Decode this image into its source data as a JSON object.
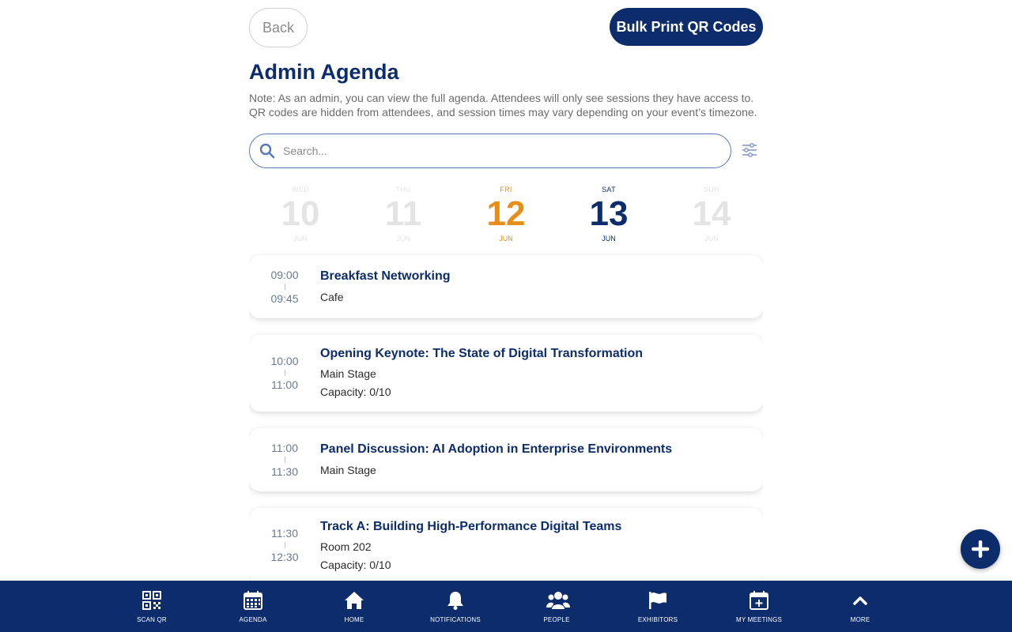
{
  "header": {
    "back_label": "Back",
    "bulk_label": "Bulk Print QR Codes",
    "title": "Admin Agenda",
    "note": "Note: As an admin, you can view the full agenda. Attendees will only see sessions they have access to. QR codes are hidden from attendees, and session times may vary depending on your event’s timezone."
  },
  "search": {
    "placeholder": "Search..."
  },
  "days": [
    {
      "dow": "WED",
      "num": "10",
      "mon": "JUN",
      "state": "muted"
    },
    {
      "dow": "THU",
      "num": "11",
      "mon": "JUN",
      "state": "muted"
    },
    {
      "dow": "FRI",
      "num": "12",
      "mon": "JUN",
      "state": "active"
    },
    {
      "dow": "SAT",
      "num": "13",
      "mon": "JUN",
      "state": "dark"
    },
    {
      "dow": "SUN",
      "num": "14",
      "mon": "JUN",
      "state": "muted"
    }
  ],
  "sessions": [
    {
      "start": "09:00",
      "end": "09:45",
      "title": "Breakfast Networking",
      "location": "Cafe"
    },
    {
      "start": "10:00",
      "end": "11:00",
      "title": "Opening Keynote: The State of Digital Transformation",
      "location": "Main Stage",
      "capacity": "Capacity: 0/10"
    },
    {
      "start": "11:00",
      "end": "11:30",
      "title": "Panel Discussion: AI Adoption in Enterprise Environments",
      "location": "Main Stage"
    },
    {
      "start": "11:30",
      "end": "12:30",
      "title": "Track A: Building High-Performance Digital Teams",
      "location": "Room 202",
      "capacity": "Capacity: 0/10"
    }
  ],
  "nav": [
    {
      "label": "SCAN QR",
      "icon": "qr-code-icon"
    },
    {
      "label": "AGENDA",
      "icon": "calendar-icon"
    },
    {
      "label": "HOME",
      "icon": "home-icon"
    },
    {
      "label": "NOTIFICATIONS",
      "icon": "bell-icon"
    },
    {
      "label": "PEOPLE",
      "icon": "people-icon"
    },
    {
      "label": "EXHIBITORS",
      "icon": "flag-icon"
    },
    {
      "label": "MY MEETINGS",
      "icon": "calendar-plus-icon"
    },
    {
      "label": "MORE",
      "icon": "chevron-up-icon"
    }
  ],
  "colors": {
    "primary": "#0c2c6c",
    "accent": "#e58e1a",
    "muted": "#e4e4e4"
  }
}
